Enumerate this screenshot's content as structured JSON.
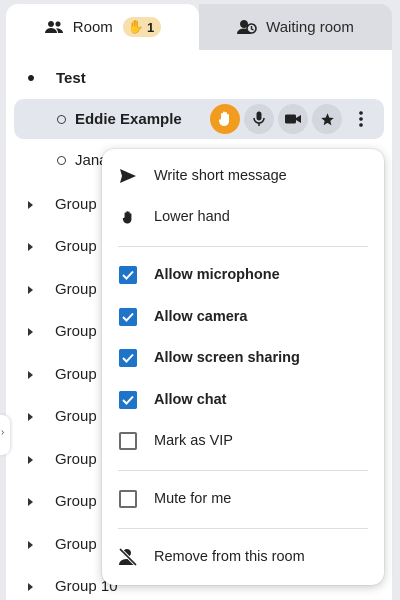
{
  "tabs": {
    "room_label": "Room",
    "raised_hands_count": "1",
    "waiting_label": "Waiting room"
  },
  "room": {
    "name": "Test",
    "user_selected": "Eddie Example",
    "user_partial": "Jana",
    "groups": [
      "Group",
      "Group",
      "Group",
      "Group",
      "Group",
      "Group",
      "Group",
      "Group",
      "Group",
      "Group 10"
    ]
  },
  "user_actions": [
    "raised-hand-icon",
    "microphone-icon",
    "camera-icon",
    "star-icon",
    "more-vertical-icon"
  ],
  "menu": {
    "write_message": "Write short message",
    "lower_hand": "Lower hand",
    "allow_microphone": "Allow microphone",
    "allow_camera": "Allow camera",
    "allow_screen_sharing": "Allow screen sharing",
    "allow_chat": "Allow chat",
    "mark_vip": "Mark as VIP",
    "mute_for_me": "Mute for me",
    "remove_from_room": "Remove from this room"
  },
  "checks": {
    "allow_microphone": true,
    "allow_camera": true,
    "allow_screen_sharing": true,
    "allow_chat": true,
    "mark_vip": false,
    "mute_for_me": false
  },
  "colors": {
    "accent": "#1e74c8",
    "raised_hand": "#f29c1f",
    "hand_badge": "#f7dfae"
  }
}
